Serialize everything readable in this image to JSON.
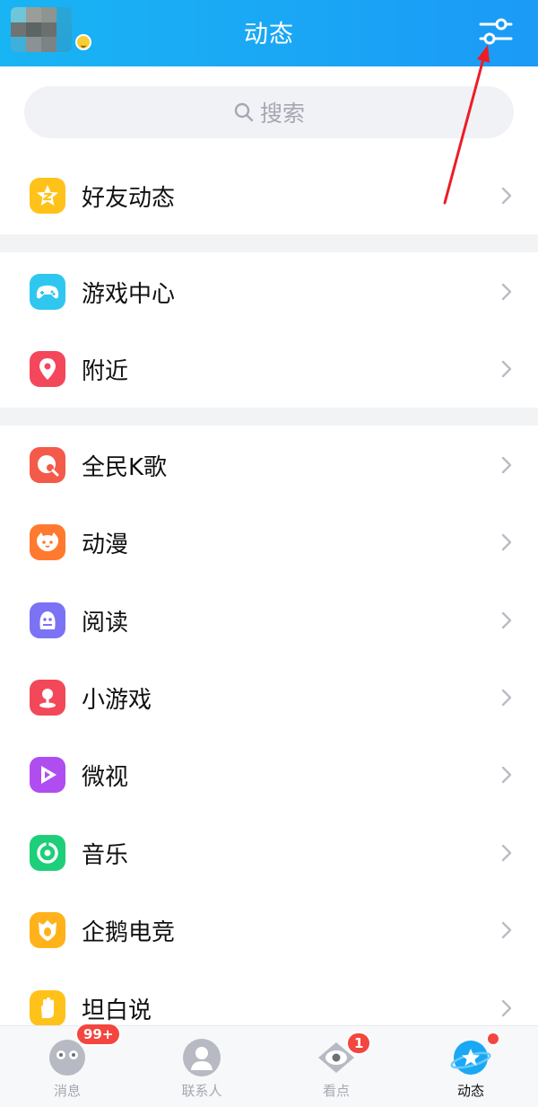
{
  "header": {
    "title": "动态",
    "filter_icon": "filter-sliders-icon",
    "background": "#1aa8f5"
  },
  "search": {
    "placeholder": "搜索",
    "icon": "search-icon"
  },
  "groups": [
    {
      "items": [
        {
          "label": "好友动态",
          "icon": "qzone-star-icon",
          "color": "#ffc21a"
        }
      ]
    },
    {
      "items": [
        {
          "label": "游戏中心",
          "icon": "gamepad-icon",
          "color": "#2fc7ef"
        },
        {
          "label": "附近",
          "icon": "location-pin-icon",
          "color": "#f4475b"
        }
      ]
    },
    {
      "items": [
        {
          "label": "全民K歌",
          "icon": "karaoke-icon",
          "color": "#f45a4a"
        },
        {
          "label": "动漫",
          "icon": "anime-face-icon",
          "color": "#ff7a2e"
        },
        {
          "label": "阅读",
          "icon": "reading-mascot-icon",
          "color": "#7b72f5"
        },
        {
          "label": "小游戏",
          "icon": "mini-game-icon",
          "color": "#f2485a"
        },
        {
          "label": "微视",
          "icon": "weishi-play-icon",
          "color": "#b04df0"
        },
        {
          "label": "音乐",
          "icon": "music-disc-icon",
          "color": "#1ecf7a"
        },
        {
          "label": "企鹅电竞",
          "icon": "esports-crest-icon",
          "color": "#ffb21a"
        },
        {
          "label": "坦白说",
          "icon": "hand-icon",
          "color": "#ffc21a"
        }
      ]
    }
  ],
  "tabbar": {
    "tabs": [
      {
        "label": "消息",
        "icon": "messages-avatar-icon",
        "badge": "99+",
        "active": false
      },
      {
        "label": "联系人",
        "icon": "contacts-icon",
        "badge": "",
        "active": false
      },
      {
        "label": "看点",
        "icon": "eye-icon",
        "badge": "1",
        "active": false
      },
      {
        "label": "动态",
        "icon": "star-planet-icon",
        "badge": "",
        "active": true
      }
    ],
    "badge_color": "#f3463f"
  }
}
